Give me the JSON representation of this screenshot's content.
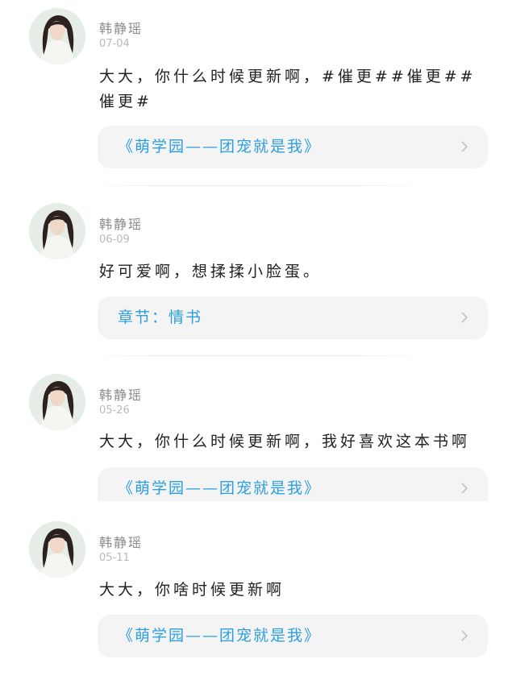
{
  "comments": [
    {
      "username": "韩静瑶",
      "date": "07-04",
      "text": "大大，你什么时候更新啊，#催更##催更##催更#",
      "link": "《萌学园——团宠就是我》"
    },
    {
      "username": "韩静瑶",
      "date": "06-09",
      "text": "好可爱啊，想揉揉小脸蛋。",
      "link": "章节：情书"
    },
    {
      "username": "韩静瑶",
      "date": "05-26",
      "text": "大大，你什么时候更新啊，我好喜欢这本书啊",
      "link": "《萌学园——团宠就是我》"
    },
    {
      "username": "韩静瑶",
      "date": "05-11",
      "text": "大大，你啥时候更新啊",
      "link": "《萌学园——团宠就是我》"
    }
  ],
  "colors": {
    "link": "#2d9fe0",
    "card_background": "#f4f4f4",
    "username": "#8a8a8a",
    "date": "#b9b9b9"
  },
  "icons": {
    "avatar": "user-avatar",
    "chevron": "chevron-right-icon"
  }
}
